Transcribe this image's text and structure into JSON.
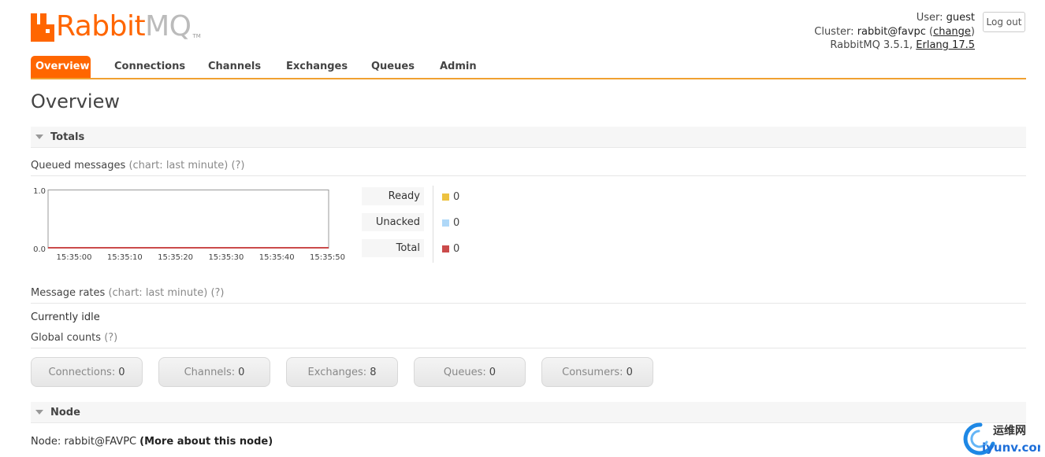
{
  "header": {
    "logo_rabbit": "Rabbit",
    "logo_mq": "MQ",
    "logo_tm": "TM",
    "user_label": "User:",
    "user_value": "guest",
    "cluster_label": "Cluster:",
    "cluster_value": "rabbit@favpc",
    "cluster_change": "change",
    "version": "RabbitMQ 3.5.1,",
    "erlang": "Erlang 17.5",
    "logout": "Log out"
  },
  "tabs": [
    {
      "label": "Overview",
      "active": true
    },
    {
      "label": "Connections"
    },
    {
      "label": "Channels"
    },
    {
      "label": "Exchanges"
    },
    {
      "label": "Queues"
    },
    {
      "label": "Admin"
    }
  ],
  "page_title": "Overview",
  "totals": {
    "heading": "Totals",
    "queued_label": "Queued messages",
    "queued_note": "(chart: last minute) (?)",
    "legend": [
      {
        "label": "Ready",
        "value": "0",
        "color": "#edc240"
      },
      {
        "label": "Unacked",
        "value": "0",
        "color": "#afd8f8"
      },
      {
        "label": "Total",
        "value": "0",
        "color": "#cb4b4b"
      }
    ],
    "rates_label": "Message rates",
    "rates_note": "(chart: last minute) (?)",
    "idle": "Currently idle",
    "global_label": "Global counts",
    "global_note": "(?)",
    "counts": [
      {
        "label": "Connections:",
        "value": "0"
      },
      {
        "label": "Channels:",
        "value": "0"
      },
      {
        "label": "Exchanges:",
        "value": "8"
      },
      {
        "label": "Queues:",
        "value": "0"
      },
      {
        "label": "Consumers:",
        "value": "0"
      }
    ]
  },
  "chart_data": {
    "type": "line",
    "x": [
      "15:35:00",
      "15:35:10",
      "15:35:20",
      "15:35:30",
      "15:35:40",
      "15:35:50"
    ],
    "y_ticks": [
      "1.0",
      "0.0"
    ],
    "ylim": [
      0,
      1
    ],
    "series": [
      {
        "name": "Ready",
        "values": [
          0,
          0,
          0,
          0,
          0,
          0
        ],
        "color": "#edc240"
      },
      {
        "name": "Unacked",
        "values": [
          0,
          0,
          0,
          0,
          0,
          0
        ],
        "color": "#afd8f8"
      },
      {
        "name": "Total",
        "values": [
          0,
          0,
          0,
          0,
          0,
          0
        ],
        "color": "#cb4b4b"
      }
    ],
    "grid": false,
    "legend": "right"
  },
  "node": {
    "heading": "Node",
    "label": "Node: rabbit@FAVPC",
    "more": "(More about this node)"
  },
  "watermark": {
    "cn": "运维网",
    "domain": "iyunv.com"
  }
}
